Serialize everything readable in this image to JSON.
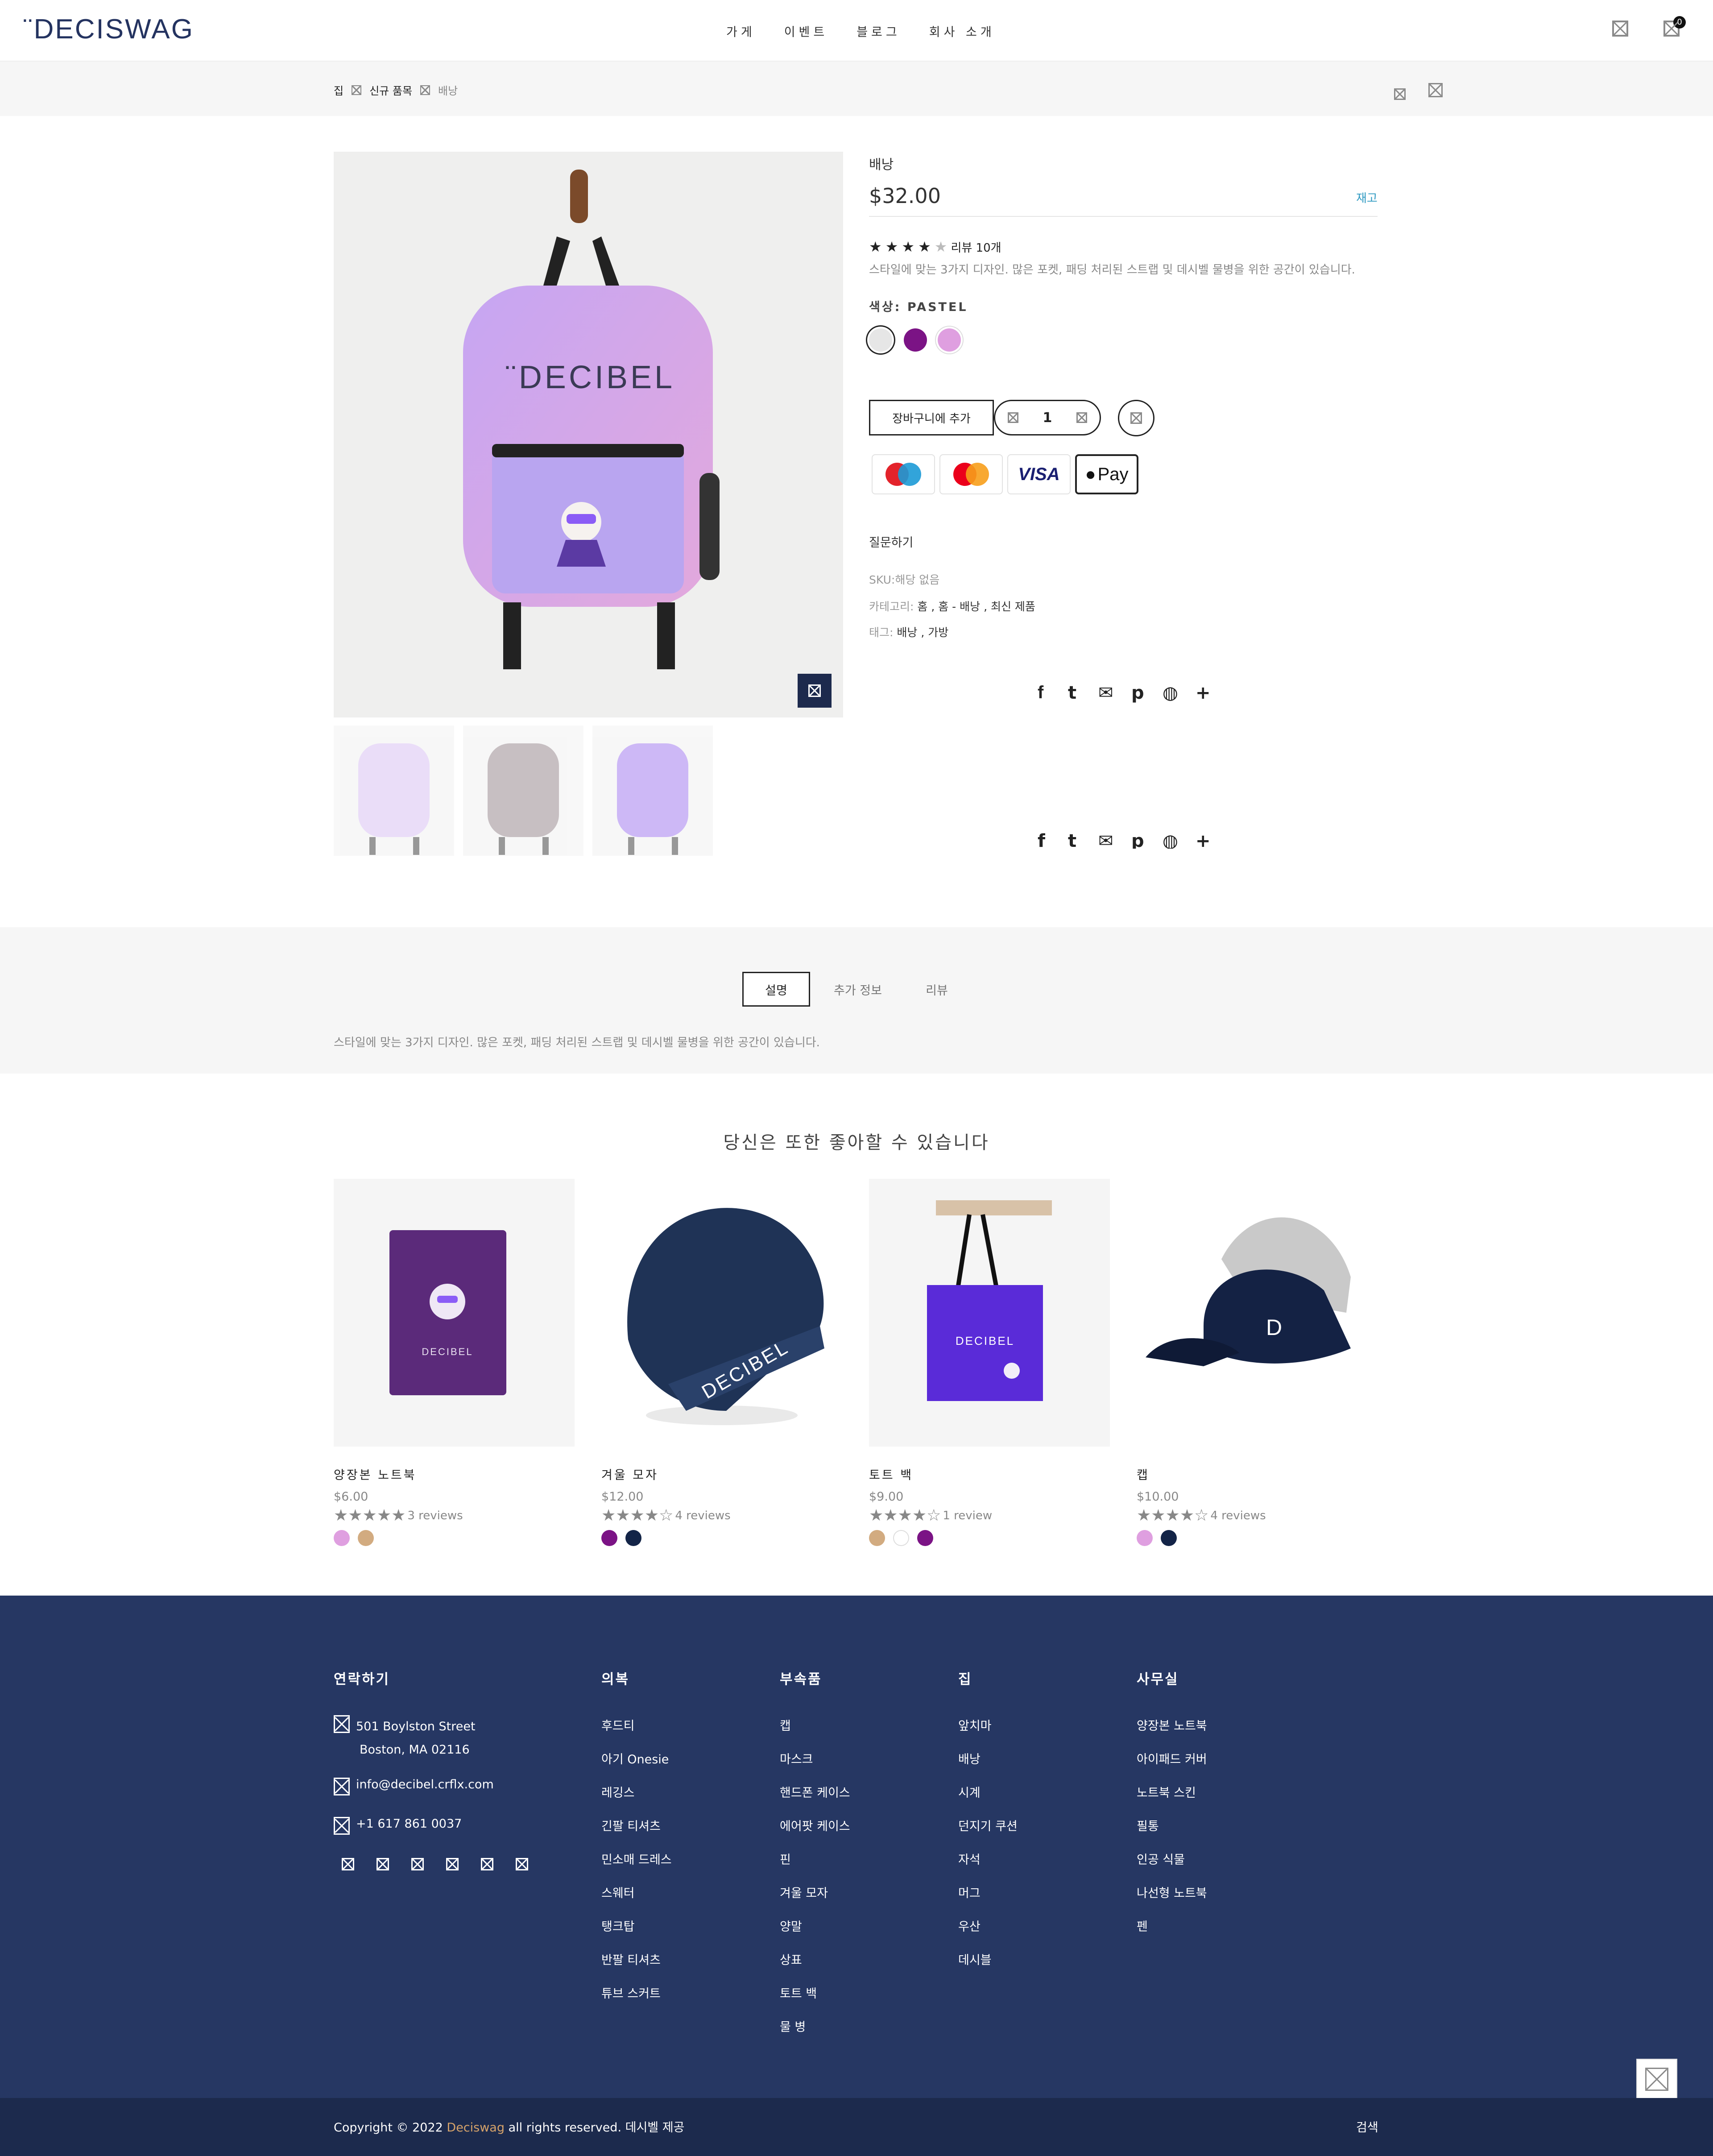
{
  "header": {
    "logo": "¨DECISWAG",
    "nav": [
      "가게",
      "이벤트",
      "블로그",
      "회사 소개"
    ],
    "wishlist_count": "0",
    "cart_count": "0"
  },
  "breadcrumb": {
    "home": "집",
    "category": "신규 품목",
    "current": "배낭"
  },
  "product": {
    "name": "배낭",
    "price": "$32.00",
    "stock": "재고",
    "rating_value": 4.5,
    "review_count": "리뷰 10개",
    "short_desc": "스타일에 맞는 3가지 디자인. 많은 포켓, 패딩 처리된 스트랩 및 데시벨 물병을 위한 공간이 있습니다.",
    "color_label": "색상: PASTEL",
    "colors": [
      "#e6e6e6",
      "#7b1385",
      "#df9fe0"
    ],
    "add_to_cart": "장바구니에 추가",
    "quantity": "1",
    "payment": [
      "Maestro",
      "Mastercard",
      "VISA",
      "Pay"
    ],
    "ask": "질문하기",
    "sku_label": "SKU:",
    "sku": "해당 없음",
    "cat_label": "카테고리:",
    "cats": "홈 , 홈 - 배낭 , 최신 제품",
    "tag_label": "태그:",
    "tags": "배낭 , 가방",
    "image_logo": "¨DECIBEL"
  },
  "tabs": {
    "desc": "설명",
    "info": "추가 정보",
    "reviews": "리뷰"
  },
  "description": "스타일에 맞는 3가지 디자인. 많은 포켓, 패딩 처리된 스트랩 및 데시벨 물병을 위한 공간이 있습니다.",
  "related": {
    "title": "당신은 또한 좋아할 수 있습니다",
    "items": [
      {
        "name": "양장본 노트북",
        "price": "$6.00",
        "rating": 5,
        "reviews": "3 reviews",
        "colors": [
          "#df9fe0",
          "#d2ab80"
        ]
      },
      {
        "name": "겨울 모자",
        "price": "$12.00",
        "rating": 4,
        "reviews": "4 reviews",
        "colors": [
          "#7b1385",
          "#132447"
        ]
      },
      {
        "name": "토트 백",
        "price": "$9.00",
        "rating": 4,
        "reviews": "1 review",
        "colors": [
          "#d2ab80",
          "#ffffff",
          "#7b1385"
        ]
      },
      {
        "name": "캡",
        "price": "$10.00",
        "rating": 4,
        "reviews": "4 reviews",
        "colors": [
          "#df9fe0",
          "#132447"
        ]
      }
    ]
  },
  "footer": {
    "contact_title": "연락하기",
    "address1": "501 Boylston Street",
    "address2": "Boston, MA 02116",
    "email": "info@decibel.crflx.com",
    "phone": "+1 617 861 0037",
    "cols": [
      {
        "title": "의복",
        "items": [
          "후드티",
          "아기 Onesie",
          "레깅스",
          "긴팔 티셔츠",
          "민소매 드레스",
          "스웨터",
          "탱크탑",
          "반팔 티셔츠",
          "튜브 스커트"
        ]
      },
      {
        "title": "부속품",
        "items": [
          "캡",
          "마스크",
          "핸드폰 케이스",
          "에어팟 케이스",
          "핀",
          "겨울 모자",
          "양말",
          "상표",
          "토트 백",
          "물 병"
        ]
      },
      {
        "title": "집",
        "items": [
          "앞치마",
          "배낭",
          "시계",
          "던지기 쿠션",
          "자석",
          "머그",
          "우산",
          "데시블"
        ]
      },
      {
        "title": "사무실",
        "items": [
          "양장본 노트북",
          "아이패드 커버",
          "노트북 스킨",
          "필통",
          "인공 식물",
          "나선형 노트북",
          "펜"
        ]
      }
    ],
    "copyright_pre": "Copyright © 2022",
    "copyright_brand": "Deciswag",
    "copyright_post": "all rights reserved. 데시벨 제공",
    "search": "검색"
  }
}
